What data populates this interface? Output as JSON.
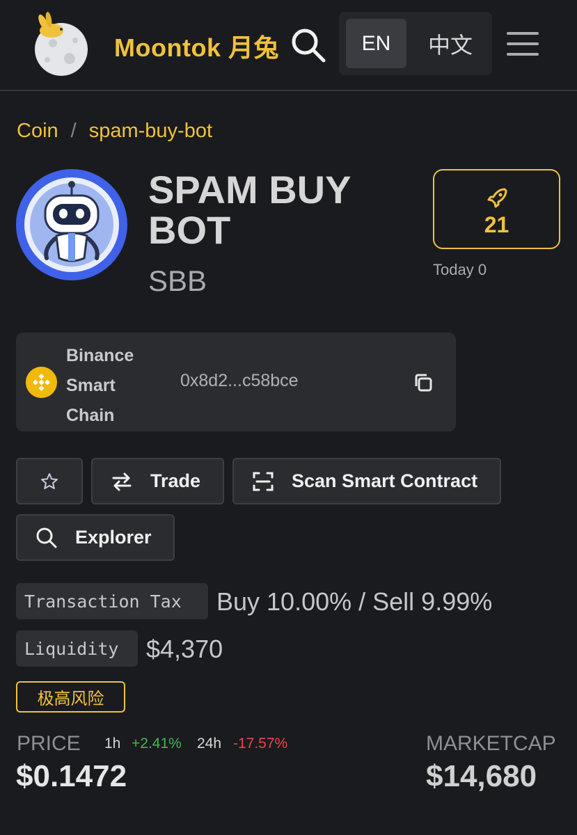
{
  "header": {
    "brand": "Moontok 月兔",
    "lang_en": "EN",
    "lang_zh": "中文"
  },
  "breadcrumb": {
    "root": "Coin",
    "separator": "/",
    "current": "spam-buy-bot"
  },
  "coin": {
    "name": "SPAM BUY BOT",
    "symbol": "SBB",
    "boost_count": "21",
    "today": "Today 0"
  },
  "chain": {
    "name": "Binance Smart Chain",
    "address": "0x8d2...c58bce"
  },
  "actions": {
    "trade": "Trade",
    "scan": "Scan Smart Contract",
    "explorer": "Explorer"
  },
  "stats": {
    "tax_label": "Transaction Tax",
    "tax_value": "Buy 10.00% / Sell 9.99%",
    "liquidity_label": "Liquidity",
    "liquidity_value": "$4,370",
    "risk_badge": "极高风险"
  },
  "price": {
    "label": "PRICE",
    "h1_label": "1h",
    "h1_change": "+2.41%",
    "h24_label": "24h",
    "h24_change": "-17.57%",
    "value": "$0.1472"
  },
  "marketcap": {
    "label": "MARKETCAP",
    "value": "$14,680"
  },
  "colors": {
    "accent": "#f0c23b",
    "positive": "#3fb950",
    "negative": "#e5484d",
    "background": "#1a1b1e"
  }
}
